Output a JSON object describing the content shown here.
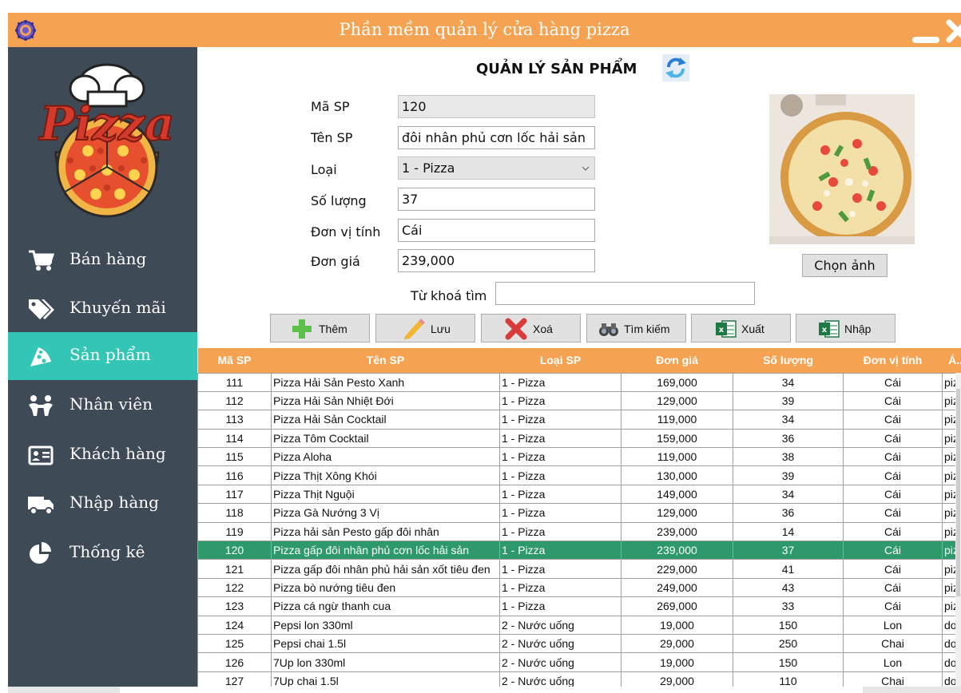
{
  "window": {
    "title": "Phần mềm quản lý cửa hàng pizza"
  },
  "colors": {
    "accent": "#f5a352",
    "sidebar": "#3f4a57",
    "active_nav": "#33c5b5",
    "selected_row": "#2e9a6c"
  },
  "logo": {
    "text": "Pizza"
  },
  "sidebar": {
    "items": [
      {
        "label": "Bán hàng",
        "icon": "cart-icon"
      },
      {
        "label": "Khuyến mãi",
        "icon": "tags-icon"
      },
      {
        "label": "Sản phẩm",
        "icon": "pizza-slice-icon"
      },
      {
        "label": "Nhân viên",
        "icon": "people-icon"
      },
      {
        "label": "Khách hàng",
        "icon": "id-card-icon"
      },
      {
        "label": "Nhập hàng",
        "icon": "truck-icon"
      },
      {
        "label": "Thống kê",
        "icon": "pie-chart-icon"
      }
    ],
    "active": "Sản phẩm"
  },
  "form": {
    "title": "QUẢN LÝ SẢN PHẨM",
    "fields": {
      "ma_sp": {
        "label": "Mã SP",
        "value": "120"
      },
      "ten_sp": {
        "label": "Tên SP",
        "value": "đôi nhân phủ cơn lốc hải sản"
      },
      "loai": {
        "label": "Loại",
        "value": "1 - Pizza"
      },
      "so_luong": {
        "label": "Số lượng",
        "value": "37"
      },
      "don_vi_tinh": {
        "label": "Đơn vị tính",
        "value": "Cái"
      },
      "don_gia": {
        "label": "Đơn giá",
        "value": "239,000"
      }
    },
    "choose_image_label": "Chọn ảnh",
    "search": {
      "label": "Từ khoá tìm",
      "value": ""
    }
  },
  "toolbar": {
    "them": "Thêm",
    "luu": "Lưu",
    "xoa": "Xoá",
    "tim_kiem": "Tìm kiếm",
    "xuat": "Xuất",
    "nhap": "Nhập"
  },
  "table": {
    "headers": [
      "Mã SP",
      "Tên SP",
      "Loại SP",
      "Đơn giá",
      "Số lượng",
      "Đơn vị tính",
      "Á..."
    ],
    "selected_id": "120",
    "rows": [
      [
        "111",
        "Pizza Hải Sản Pesto Xanh",
        "1 - Pizza",
        "169,000",
        "34",
        "Cái",
        "piz..."
      ],
      [
        "112",
        "Pizza Hải Sản Nhiệt Đới",
        "1 - Pizza",
        "129,000",
        "39",
        "Cái",
        "piz..."
      ],
      [
        "113",
        "Pizza Hải Sản Cocktail",
        "1 - Pizza",
        "119,000",
        "34",
        "Cái",
        "piz..."
      ],
      [
        "114",
        "Pizza Tôm Cocktail",
        "1 - Pizza",
        "159,000",
        "36",
        "Cái",
        "piz..."
      ],
      [
        "115",
        "Pizza Aloha",
        "1 - Pizza",
        "119,000",
        "38",
        "Cái",
        "piz..."
      ],
      [
        "116",
        "Pizza Thịt Xông Khói",
        "1 - Pizza",
        "130,000",
        "39",
        "Cái",
        "piz..."
      ],
      [
        "117",
        "Pizza Thịt Nguội",
        "1 - Pizza",
        "149,000",
        "34",
        "Cái",
        "piz..."
      ],
      [
        "118",
        "Pizza Gà Nướng 3 Vị",
        "1 - Pizza",
        "129,000",
        "36",
        "Cái",
        "piz..."
      ],
      [
        "119",
        "Pizza hải sản Pesto gấp đôi nhân",
        "1 - Pizza",
        "239,000",
        "14",
        "Cái",
        "piz..."
      ],
      [
        "120",
        "Pizza gấp đôi nhân phủ cơn lốc hải sản",
        "1 - Pizza",
        "239,000",
        "37",
        "Cái",
        "piz..."
      ],
      [
        "121",
        "Pizza gấp đôi nhân phủ hải sản xốt tiêu đen",
        "1 - Pizza",
        "229,000",
        "41",
        "Cái",
        "piz..."
      ],
      [
        "122",
        "Pizza bò nướng tiêu đen",
        "1 - Pizza",
        "249,000",
        "43",
        "Cái",
        "piz..."
      ],
      [
        "123",
        "Pizza cá ngừ thanh cua",
        "1 - Pizza",
        "269,000",
        "33",
        "Cái",
        "piz..."
      ],
      [
        "124",
        "Pepsi lon 330ml",
        "2 - Nước uống",
        "19,000",
        "150",
        "Lon",
        "do..."
      ],
      [
        "125",
        "Pepsi chai 1.5l",
        "2 - Nước uống",
        "29,000",
        "250",
        "Chai",
        "do..."
      ],
      [
        "126",
        "7Up lon 330ml",
        "2 - Nước uống",
        "19,000",
        "150",
        "Lon",
        "do..."
      ],
      [
        "127",
        "7Up chai 1.5l",
        "2 - Nước uống",
        "29,000",
        "110",
        "Chai",
        "do..."
      ]
    ]
  }
}
